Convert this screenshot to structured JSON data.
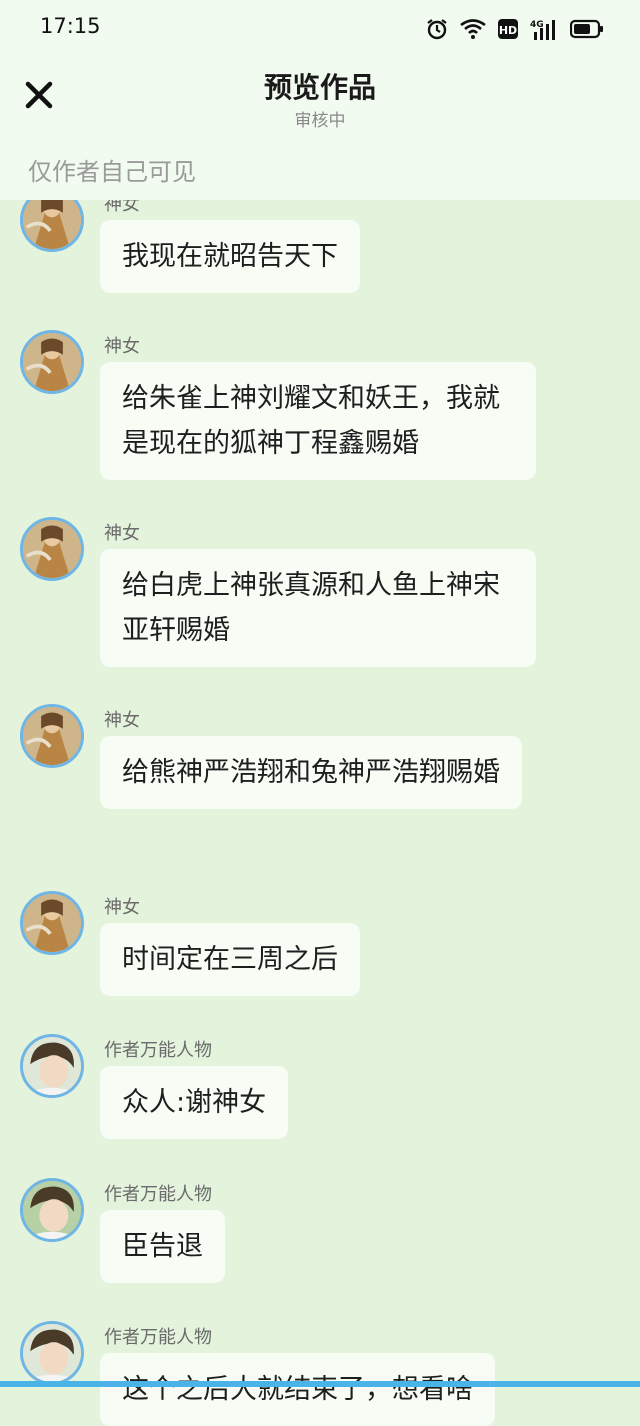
{
  "status_bar": {
    "time": "17:15",
    "icons": [
      "alarm-icon",
      "wifi-icon",
      "hd-icon",
      "4g-signal-icon",
      "battery-icon"
    ],
    "network_label": "4G",
    "hd_label": "HD"
  },
  "header": {
    "title": "预览作品",
    "subtitle": "审核中",
    "close_icon": "close-icon",
    "notice": "仅作者自己可见"
  },
  "messages": [
    {
      "sender": "神女",
      "text": "我现在就昭告天下",
      "avatar": "goddess-avatar"
    },
    {
      "sender": "神女",
      "text": "给朱雀上神刘耀文和妖王，我就是现在的狐神丁程鑫赐婚",
      "avatar": "goddess-avatar"
    },
    {
      "sender": "神女",
      "text": "给白虎上神张真源和人鱼上神宋亚轩赐婚",
      "avatar": "goddess-avatar"
    },
    {
      "sender": "神女",
      "text": "给熊神严浩翔和兔神严浩翔赐婚",
      "avatar": "goddess-avatar"
    },
    {
      "sender": "神女",
      "text": "时间定在三周之后",
      "avatar": "goddess-avatar"
    },
    {
      "sender": "作者万能人物",
      "text": "众人:谢神女",
      "avatar": "author-avatar"
    },
    {
      "sender": "作者万能人物",
      "text": "臣告退",
      "avatar": "author-avatar"
    },
    {
      "sender": "作者万能人物",
      "text": "这个之后大就结束了，想看啥",
      "avatar": "author-avatar"
    }
  ],
  "colors": {
    "background": "#e3f3dc",
    "header_bg": "#f1fbef",
    "bubble": "#f7fcf5",
    "avatar_border": "#6fb6e6"
  }
}
